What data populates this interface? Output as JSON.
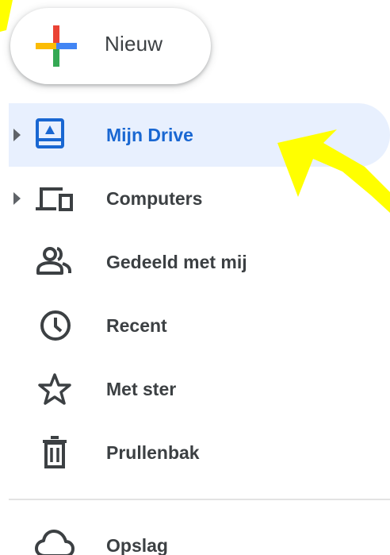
{
  "new_button": {
    "label": "Nieuw",
    "icon": "plus-multicolor-icon"
  },
  "nav": {
    "items": [
      {
        "label": "Mijn Drive",
        "icon": "my-drive-icon",
        "active": true,
        "expandable": true
      },
      {
        "label": "Computers",
        "icon": "computers-icon",
        "active": false,
        "expandable": true
      },
      {
        "label": "Gedeeld met mij",
        "icon": "shared-people-icon",
        "active": false,
        "expandable": false
      },
      {
        "label": "Recent",
        "icon": "clock-icon",
        "active": false,
        "expandable": false
      },
      {
        "label": "Met ster",
        "icon": "star-icon",
        "active": false,
        "expandable": false
      },
      {
        "label": "Prullenbak",
        "icon": "trash-icon",
        "active": false,
        "expandable": false
      }
    ]
  },
  "storage": {
    "label": "Opslag",
    "icon": "cloud-icon"
  },
  "colors": {
    "active_bg": "#e8f0fe",
    "active_text": "#1967d2",
    "text": "#3c4043",
    "icon": "#5f6368",
    "annotation_arrow": "#ffff00"
  }
}
